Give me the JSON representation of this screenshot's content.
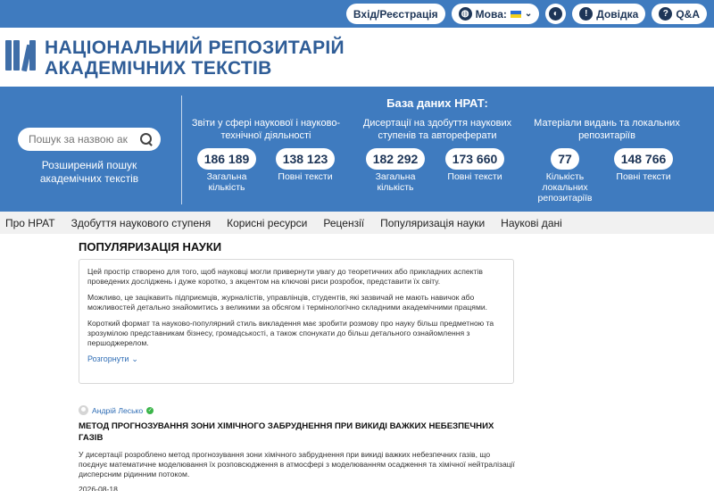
{
  "topbar": {
    "login": "Вхід/Реєстрація",
    "language": "Мова:",
    "help": "Довідка",
    "qa": "Q&A"
  },
  "logo": {
    "line1": "НАЦІОНАЛЬНИЙ РЕПОЗИТАРІЙ",
    "line2": "АКАДЕМІЧНИХ ТЕКСТІВ"
  },
  "banner": {
    "search_placeholder": "Пошук за назвою ак",
    "advanced_search": "Розширений пошук академічних текстів",
    "db_title": "База даних НРАТ:",
    "groups": [
      {
        "title": "Звіти у сфері наукової і науково-технічної діяльності",
        "stats": [
          {
            "value": "186 189",
            "label": "Загальна кількість"
          },
          {
            "value": "138 123",
            "label": "Повні тексти"
          }
        ]
      },
      {
        "title": "Дисертації на здобуття наукових ступенів та автореферати",
        "stats": [
          {
            "value": "182 292",
            "label": "Загальна кількість"
          },
          {
            "value": "173 660",
            "label": "Повні тексти"
          }
        ]
      },
      {
        "title": "Матеріали видань та локальних репозитаріїв",
        "stats": [
          {
            "value": "77",
            "label": "Кількість локальних репозитаріїв"
          },
          {
            "value": "148 766",
            "label": "Повні тексти"
          }
        ]
      }
    ]
  },
  "nav": [
    "Про НРАТ",
    "Здобуття наукового ступеня",
    "Корисні ресурси",
    "Рецензії",
    "Популяризація науки",
    "Наукові дані"
  ],
  "page": {
    "title": "ПОПУЛЯРИЗАЦІЯ НАУКИ",
    "intro": [
      "Цей простір створено для того, щоб науковці могли привернути увагу до теоретичних або прикладних аспектів проведених досліджень і дуже коротко, з акцентом на ключові риси розробок, представити їх світу.",
      "Можливо, це зацікавить підприємців, журналістів, управлінців, студентів, які зазвичай не мають навичок або можливостей детально знайомитись з великими за обсягом і термінологічно складними академічними працями.",
      "Короткий формат та науково-популярний стиль викладення має зробити розмову про науку більш предметною та зрозумілою представникам бізнесу, громадськості, а також спонукати до більш детального ознайомлення з першоджерелом."
    ],
    "expand": "Розгорнути"
  },
  "article": {
    "author": "Андрій Лесько",
    "title": "МЕТОД ПРОГНОЗУВАННЯ ЗОНИ ХІМІЧНОГО ЗАБРУДНЕННЯ ПРИ ВИКИДІ ВАЖКИХ НЕБЕЗПЕЧНИХ ГАЗІВ",
    "description": "У дисертації розроблено метод прогнозування зони хімічного забруднення при викиді важких небезпечних газів, що поєднує математичне моделювання їх розповсюдження в атмосфері з моделюванням осадження та хімічної нейтралізації дисперсним рідинним потоком.",
    "date": "2026-08-18"
  },
  "colors": {
    "brand": "#3f7bbf",
    "logo_text": "#2f5d97",
    "link": "#2f6db5"
  }
}
